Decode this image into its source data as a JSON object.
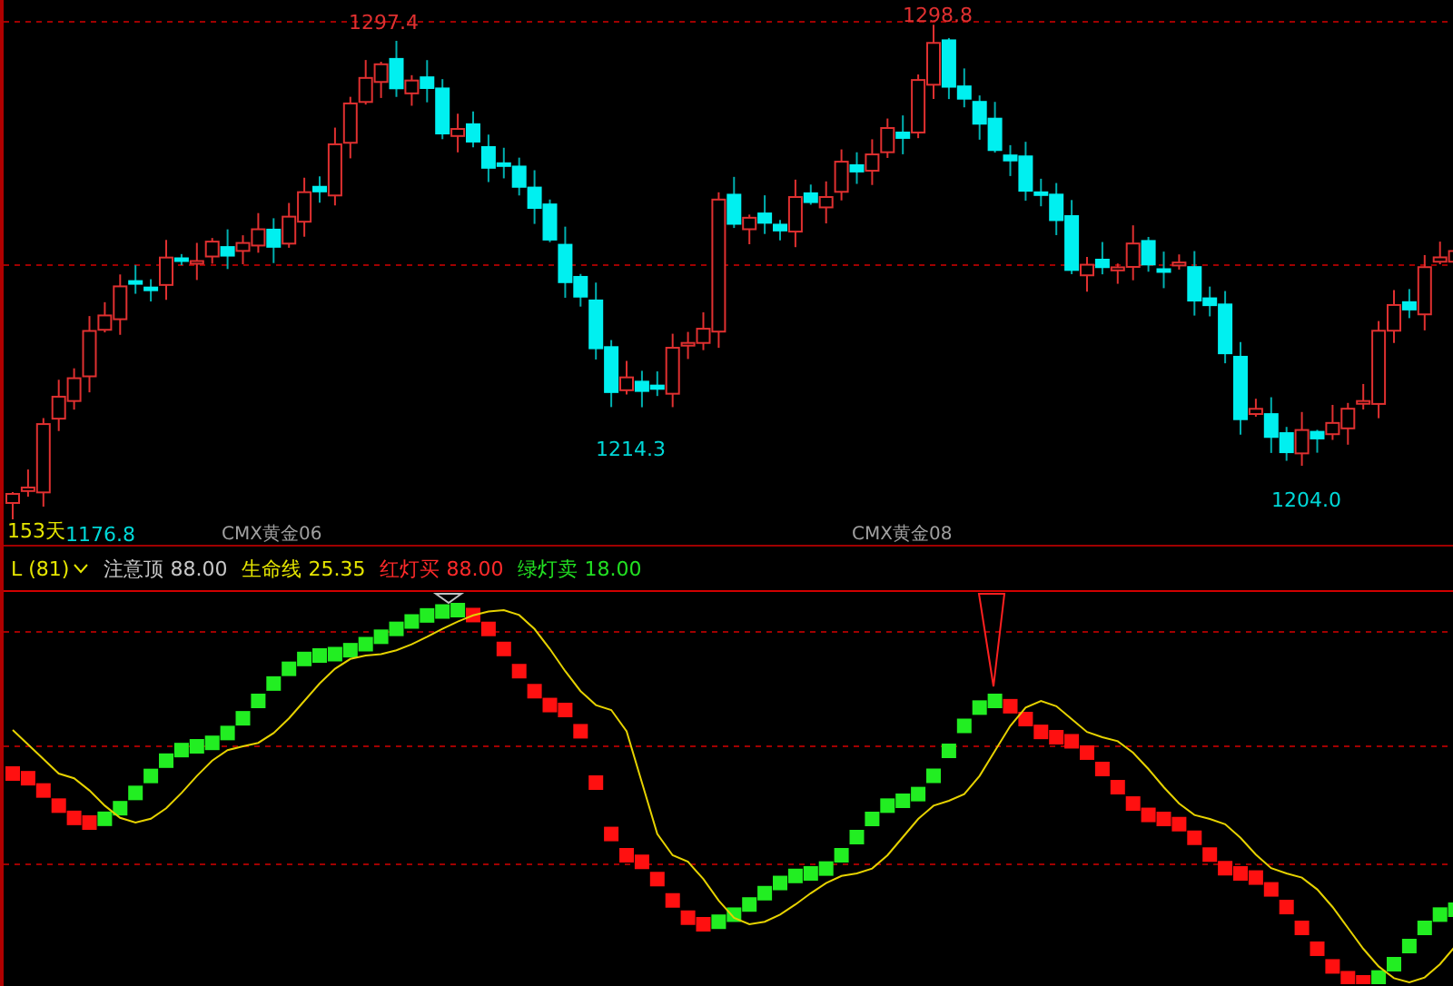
{
  "main_chart": {
    "price_labels": [
      {
        "text": "1297.4",
        "kind": "high"
      },
      {
        "text": "1214.3",
        "kind": "low"
      },
      {
        "text": "1298.8",
        "kind": "high"
      },
      {
        "text": "1204.0",
        "kind": "low"
      },
      {
        "text": "1176.8",
        "kind": "low"
      }
    ],
    "days_label": "153天",
    "contract_labels": [
      "CMX黄金06",
      "CMX黄金08"
    ]
  },
  "indicator": {
    "name": "L (81)",
    "params": [
      {
        "label": "注意顶",
        "value": "88.00",
        "color": "#c8c8c8"
      },
      {
        "label": "生命线",
        "value": "25.35",
        "color": "#e6e600"
      },
      {
        "label": "红灯买",
        "value": "88.00",
        "color": "#ff2a2a"
      },
      {
        "label": "绿灯卖",
        "value": "18.00",
        "color": "#22e022"
      }
    ]
  }
}
